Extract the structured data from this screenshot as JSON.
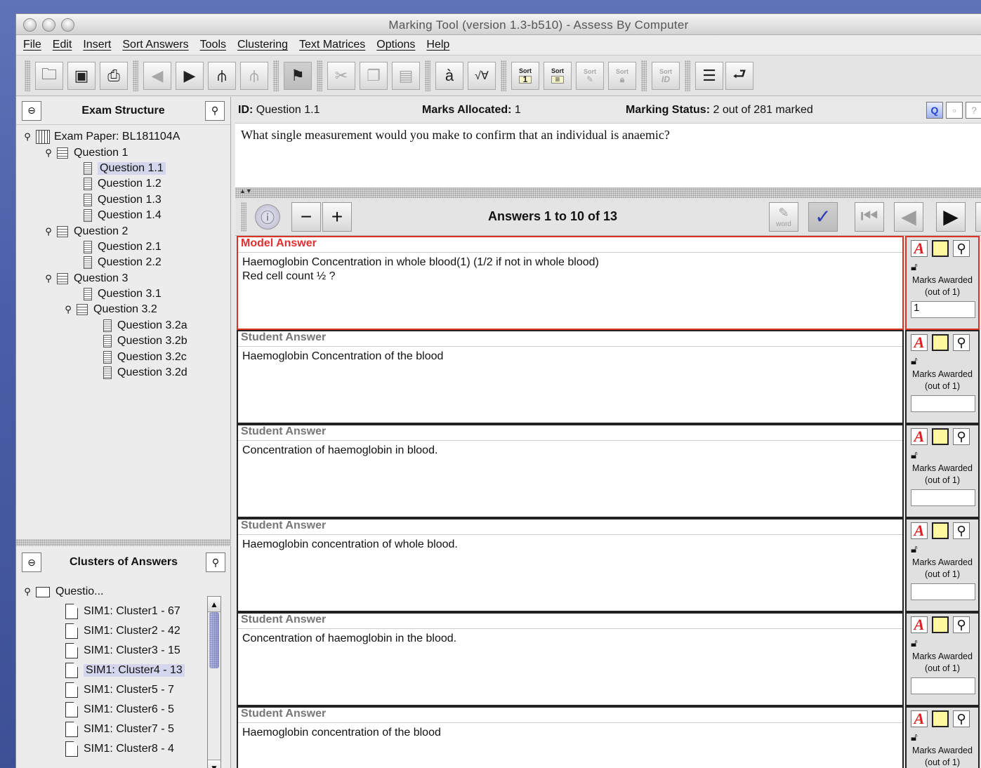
{
  "window": {
    "title": "Marking Tool (version 1.3-b510) - Assess By Computer"
  },
  "menu": [
    "File",
    "Edit",
    "Insert",
    "Sort Answers",
    "Tools",
    "Clustering",
    "Text Matrices",
    "Options",
    "Help"
  ],
  "toolbar": {
    "sort_labels": [
      "Sort",
      "Sort",
      "Sort",
      "Sort",
      "Sort"
    ],
    "sort_sub": [
      "1",
      "",
      "",
      "",
      "ID"
    ]
  },
  "exam_structure": {
    "title": "Exam Structure",
    "root": "Exam Paper: BL181104A",
    "items": [
      {
        "label": "Question 1",
        "level": 1,
        "type": "group"
      },
      {
        "label": "Question 1.1",
        "level": 2,
        "type": "leaf",
        "selected": true
      },
      {
        "label": "Question 1.2",
        "level": 2,
        "type": "leaf"
      },
      {
        "label": "Question 1.3",
        "level": 2,
        "type": "leaf"
      },
      {
        "label": "Question 1.4",
        "level": 2,
        "type": "leaf"
      },
      {
        "label": "Question 2",
        "level": 1,
        "type": "group"
      },
      {
        "label": "Question 2.1",
        "level": 2,
        "type": "leaf"
      },
      {
        "label": "Question 2.2",
        "level": 2,
        "type": "leaf"
      },
      {
        "label": "Question 3",
        "level": 1,
        "type": "group"
      },
      {
        "label": "Question 3.1",
        "level": 2,
        "type": "leaf"
      },
      {
        "label": "Question 3.2",
        "level": 2,
        "type": "group"
      },
      {
        "label": "Question 3.2a",
        "level": 3,
        "type": "leaf"
      },
      {
        "label": "Question 3.2b",
        "level": 3,
        "type": "leaf"
      },
      {
        "label": "Question 3.2c",
        "level": 3,
        "type": "leaf"
      },
      {
        "label": "Question 3.2d",
        "level": 3,
        "type": "leaf"
      }
    ]
  },
  "clusters": {
    "title": "Clusters of Answers",
    "root": "Questio...",
    "items": [
      {
        "label": "SIM1: Cluster1 - 67"
      },
      {
        "label": "SIM1: Cluster2 - 42"
      },
      {
        "label": "SIM1: Cluster3 - 15"
      },
      {
        "label": "SIM1: Cluster4 - 13",
        "selected": true
      },
      {
        "label": "SIM1: Cluster5 - 7"
      },
      {
        "label": "SIM1: Cluster6 - 5"
      },
      {
        "label": "SIM1: Cluster7 - 5"
      },
      {
        "label": "SIM1: Cluster8 - 4"
      }
    ]
  },
  "question": {
    "id_label": "ID:",
    "id_value": "Question 1.1",
    "marks_label": "Marks Allocated:",
    "marks_value": "1",
    "status_label": "Marking Status:",
    "status_value": "2 out of 281 marked",
    "text": "What single measurement would you make to confirm that an individual is anaemic?"
  },
  "answers_bar": {
    "label": "Answers 1 to 10 of 13",
    "word_label": "word"
  },
  "answers": [
    {
      "kind": "Model Answer",
      "lines": [
        "Haemoglobin Concentration in whole blood(1) (1/2 if not in whole blood)",
        "Red cell count ½ ?"
      ],
      "mark": "1",
      "model": true
    },
    {
      "kind": "Student Answer",
      "lines": [
        "Haemoglobin Concentration of the blood"
      ],
      "mark": ""
    },
    {
      "kind": "Student Answer",
      "lines": [
        "Concentration of haemoglobin in blood."
      ],
      "mark": ""
    },
    {
      "kind": "Student Answer",
      "lines": [
        "Haemoglobin concentration of whole blood."
      ],
      "mark": ""
    },
    {
      "kind": "Student Answer",
      "lines": [
        "Concentration of haemoglobin in the blood."
      ],
      "mark": ""
    },
    {
      "kind": "Student Answer",
      "lines": [
        "Haemoglobin concentration of the blood"
      ],
      "mark": ""
    }
  ],
  "marks_awarded_label": "Marks Awarded",
  "out_of_label": "(out of 1)",
  "colors": {
    "model_border": "#dd3322",
    "selection": "#d3d6ec"
  }
}
